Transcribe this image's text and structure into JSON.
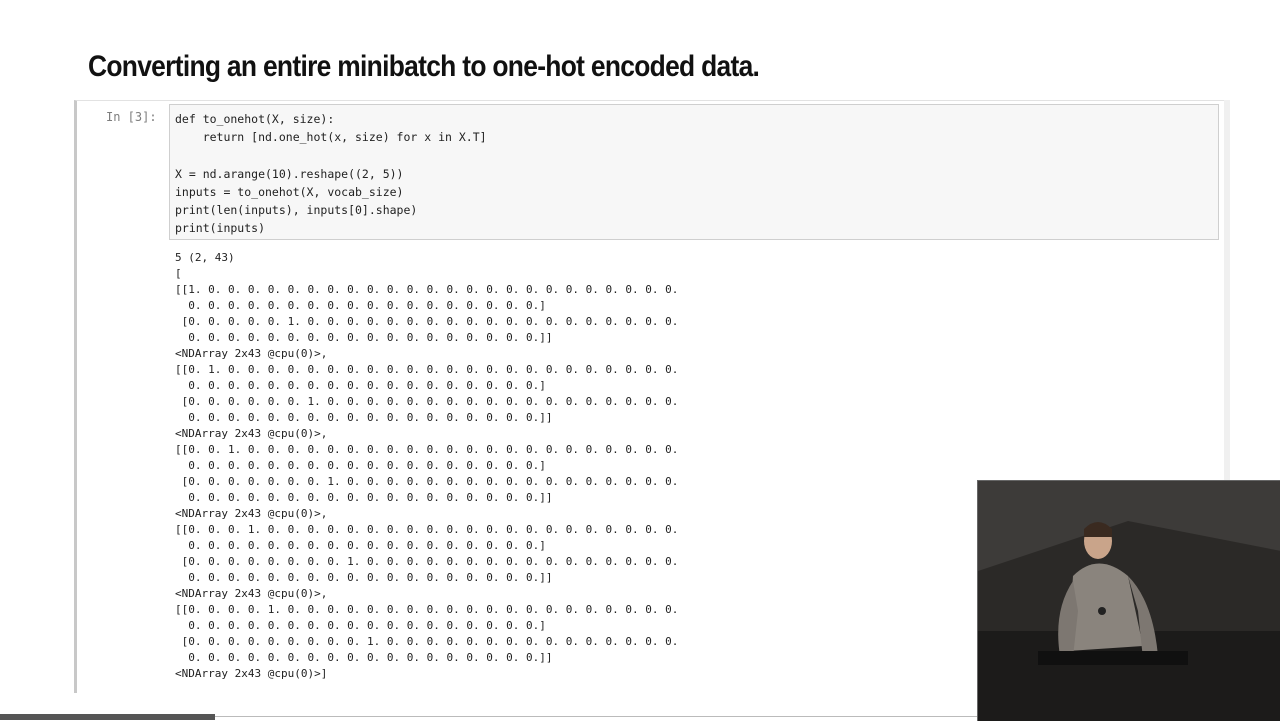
{
  "slide": {
    "title": "Converting an entire minibatch to one-hot encoded data."
  },
  "cell": {
    "prompt": "In [3]:",
    "code": [
      "def to_onehot(X, size):",
      "    return [nd.one_hot(x, size) for x in X.T]",
      "",
      "X = nd.arange(10).reshape((2, 5))",
      "inputs = to_onehot(X, vocab_size)",
      "print(len(inputs), inputs[0].shape)",
      "print(inputs)"
    ],
    "output": [
      "5 (2, 43)",
      "[",
      "[[1. 0. 0. 0. 0. 0. 0. 0. 0. 0. 0. 0. 0. 0. 0. 0. 0. 0. 0. 0. 0. 0. 0. 0. 0.",
      "  0. 0. 0. 0. 0. 0. 0. 0. 0. 0. 0. 0. 0. 0. 0. 0. 0. 0.]",
      " [0. 0. 0. 0. 0. 1. 0. 0. 0. 0. 0. 0. 0. 0. 0. 0. 0. 0. 0. 0. 0. 0. 0. 0. 0.",
      "  0. 0. 0. 0. 0. 0. 0. 0. 0. 0. 0. 0. 0. 0. 0. 0. 0. 0.]]",
      "<NDArray 2x43 @cpu(0)>,",
      "[[0. 1. 0. 0. 0. 0. 0. 0. 0. 0. 0. 0. 0. 0. 0. 0. 0. 0. 0. 0. 0. 0. 0. 0. 0.",
      "  0. 0. 0. 0. 0. 0. 0. 0. 0. 0. 0. 0. 0. 0. 0. 0. 0. 0.]",
      " [0. 0. 0. 0. 0. 0. 1. 0. 0. 0. 0. 0. 0. 0. 0. 0. 0. 0. 0. 0. 0. 0. 0. 0. 0.",
      "  0. 0. 0. 0. 0. 0. 0. 0. 0. 0. 0. 0. 0. 0. 0. 0. 0. 0.]]",
      "<NDArray 2x43 @cpu(0)>,",
      "[[0. 0. 1. 0. 0. 0. 0. 0. 0. 0. 0. 0. 0. 0. 0. 0. 0. 0. 0. 0. 0. 0. 0. 0. 0.",
      "  0. 0. 0. 0. 0. 0. 0. 0. 0. 0. 0. 0. 0. 0. 0. 0. 0. 0.]",
      " [0. 0. 0. 0. 0. 0. 0. 1. 0. 0. 0. 0. 0. 0. 0. 0. 0. 0. 0. 0. 0. 0. 0. 0. 0.",
      "  0. 0. 0. 0. 0. 0. 0. 0. 0. 0. 0. 0. 0. 0. 0. 0. 0. 0.]]",
      "<NDArray 2x43 @cpu(0)>,",
      "[[0. 0. 0. 1. 0. 0. 0. 0. 0. 0. 0. 0. 0. 0. 0. 0. 0. 0. 0. 0. 0. 0. 0. 0. 0.",
      "  0. 0. 0. 0. 0. 0. 0. 0. 0. 0. 0. 0. 0. 0. 0. 0. 0. 0.]",
      " [0. 0. 0. 0. 0. 0. 0. 0. 1. 0. 0. 0. 0. 0. 0. 0. 0. 0. 0. 0. 0. 0. 0. 0. 0.",
      "  0. 0. 0. 0. 0. 0. 0. 0. 0. 0. 0. 0. 0. 0. 0. 0. 0. 0.]]",
      "<NDArray 2x43 @cpu(0)>,",
      "[[0. 0. 0. 0. 1. 0. 0. 0. 0. 0. 0. 0. 0. 0. 0. 0. 0. 0. 0. 0. 0. 0. 0. 0. 0.",
      "  0. 0. 0. 0. 0. 0. 0. 0. 0. 0. 0. 0. 0. 0. 0. 0. 0. 0.]",
      " [0. 0. 0. 0. 0. 0. 0. 0. 0. 1. 0. 0. 0. 0. 0. 0. 0. 0. 0. 0. 0. 0. 0. 0. 0.",
      "  0. 0. 0. 0. 0. 0. 0. 0. 0. 0. 0. 0. 0. 0. 0. 0. 0. 0.]]",
      "<NDArray 2x43 @cpu(0)>]"
    ]
  },
  "colors": {
    "code_background": "#f7f7f7",
    "code_border": "#cfcfcf",
    "prompt": "#7d7d7d",
    "text": "#222222"
  }
}
